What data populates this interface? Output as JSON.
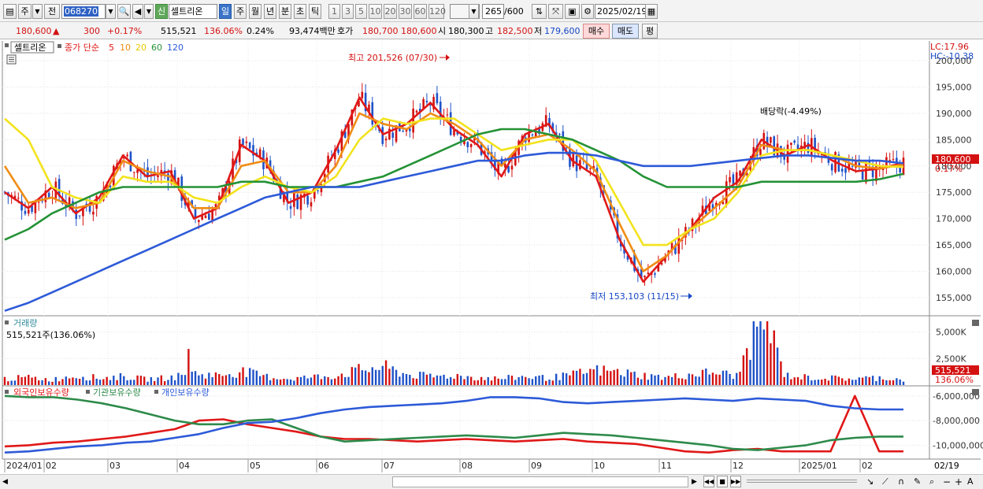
{
  "toolbar": {
    "market_type": "주",
    "prev_label": "전",
    "code": "068270",
    "credit_badge": "신",
    "stock_name": "셀트리온",
    "periods": [
      "일",
      "주",
      "월",
      "년",
      "분",
      "초",
      "틱"
    ],
    "active_period": "일",
    "intervals": [
      "1",
      "3",
      "5",
      "10",
      "20",
      "30",
      "60",
      "120"
    ],
    "count": "265",
    "count_total": "/600",
    "date": "2025/02/19"
  },
  "quote": {
    "price": "180,600",
    "change_symbol": "▲",
    "change": "300",
    "change_pct": "+0.17%",
    "volume": "515,521",
    "volume_ratio": "136.06%",
    "turnover": "0.24%",
    "amount": "93,474백만",
    "hoga_label": "호가",
    "bid1": "180,700",
    "bid2": "180,600",
    "open_label": "시",
    "open": "180,300",
    "high_label": "고",
    "high": "182,500",
    "low_label": "저",
    "low": "179,600",
    "buy_label": "매수",
    "sell_label": "매도",
    "eval_label": "평"
  },
  "price_panel": {
    "stock_label": "셀트리온",
    "ma_label": "종가 단순",
    "ma_periods": [
      "5",
      "10",
      "20",
      "60",
      "120"
    ],
    "max_annotation": "최고 201,526 (07/30)",
    "min_annotation": "최저 153,103 (11/15)",
    "dividend_annotation": "배당락(-4.49%)",
    "lc": "LC:17.96",
    "hc": "HC:-10.38",
    "current_price_tag": "180,600",
    "current_pct_tag": "0.17%",
    "y_ticks": [
      "200,000",
      "195,000",
      "190,000",
      "185,000",
      "180,000",
      "175,000",
      "170,000",
      "165,000",
      "160,000",
      "155,000"
    ]
  },
  "volume_panel": {
    "title": "거래량",
    "value": "515,521주(136.06%)",
    "y_ticks": [
      "5,000K",
      "2,500K"
    ],
    "current_tag": "515,521",
    "current_pct_tag": "136.06%"
  },
  "holding_panel": {
    "series_names": [
      "외국인보유수량",
      "기관보유수량",
      "개인보유수량"
    ],
    "y_ticks": [
      "-6,000,000",
      "-8,000,000",
      "-10,000,000"
    ]
  },
  "x_axis": {
    "labels": [
      "2024/01",
      "02",
      "03",
      "04",
      "05",
      "06",
      "07",
      "08",
      "09",
      "10",
      "11",
      "12",
      "2025/01",
      "02"
    ],
    "end_label": "02/19"
  },
  "colors": {
    "up": "#d41111",
    "down": "#1f52c8",
    "ma5": "#e01818",
    "ma10": "#f08c14",
    "ma20": "#f2e31c",
    "ma60": "#249236",
    "ma120": "#2d5ad8",
    "foreign": "#e01818",
    "institution": "#2d8a4a",
    "individual": "#2d5ad8"
  },
  "chart_data": [
    {
      "type": "candlestick",
      "title": "셀트리온",
      "x_range": [
        "2024/01",
        "2025/02/19"
      ],
      "ylim": [
        152000,
        201500
      ],
      "series": [
        {
          "name": "5",
          "values": [
            175000,
            172000,
            176000,
            171000,
            174000,
            182000,
            178000,
            179000,
            170000,
            172000,
            184000,
            181000,
            173000,
            175000,
            183000,
            193000,
            186000,
            188000,
            192000,
            187000,
            184000,
            178000,
            186000,
            188000,
            181000,
            178000,
            166000,
            158000,
            163000,
            168000,
            174000,
            177000,
            185000,
            182000,
            184000,
            181000,
            179000,
            179500,
            180600
          ]
        },
        {
          "name": "10",
          "values": [
            180000,
            173000,
            174000,
            172000,
            173000,
            181000,
            179000,
            178000,
            172000,
            172000,
            180000,
            181000,
            175000,
            175000,
            180000,
            190000,
            188000,
            187000,
            190000,
            188000,
            185000,
            180000,
            185000,
            186000,
            183000,
            179000,
            169000,
            160000,
            163000,
            168000,
            172000,
            176000,
            184000,
            183000,
            183000,
            182000,
            180000,
            179500,
            180300
          ]
        },
        {
          "name": "20",
          "values": [
            189000,
            185000,
            176000,
            174000,
            173000,
            178000,
            177000,
            177000,
            174000,
            173000,
            176000,
            178000,
            176000,
            175000,
            178000,
            185000,
            189000,
            188000,
            189000,
            189000,
            186000,
            183000,
            184000,
            185000,
            185000,
            181000,
            173000,
            165000,
            165000,
            168000,
            170000,
            175000,
            182000,
            183000,
            183000,
            182000,
            181000,
            180000,
            179800
          ]
        },
        {
          "name": "60",
          "values": [
            166000,
            168000,
            171000,
            173000,
            175000,
            176000,
            176000,
            176000,
            176000,
            176000,
            177000,
            177000,
            176000,
            176000,
            176000,
            177000,
            178000,
            180000,
            182000,
            184000,
            186000,
            187000,
            187000,
            186000,
            185000,
            183000,
            181000,
            178000,
            176000,
            176000,
            176000,
            176000,
            177000,
            177000,
            177000,
            177000,
            177000,
            177500,
            178500
          ]
        },
        {
          "name": "120",
          "values": [
            152500,
            154000,
            156000,
            158000,
            160000,
            162000,
            164000,
            166000,
            168000,
            170000,
            172000,
            174000,
            175000,
            176000,
            176000,
            176000,
            177000,
            178000,
            179000,
            180000,
            181000,
            181000,
            182000,
            182500,
            182500,
            182000,
            181000,
            180000,
            180000,
            180000,
            180500,
            181000,
            181500,
            182000,
            182000,
            181500,
            181000,
            181000,
            180500
          ]
        }
      ]
    },
    {
      "type": "bar",
      "title": "거래량",
      "ylim": [
        0,
        6000000
      ],
      "values": [
        600,
        700,
        500,
        900,
        650,
        800,
        550,
        700,
        1100,
        900,
        1300,
        800,
        600,
        750,
        900,
        1400,
        1700,
        1000,
        800,
        900,
        700,
        600,
        800,
        650,
        950,
        1400,
        1200,
        900,
        700,
        1000,
        1200,
        850,
        7200,
        900,
        700,
        650,
        600,
        700,
        515
      ]
    },
    {
      "type": "line",
      "ylim": [
        -11000000,
        -5500000
      ],
      "series": [
        {
          "name": "외국인보유수량",
          "values": [
            -10100000,
            -10000000,
            -9800000,
            -9700000,
            -9500000,
            -9300000,
            -9000000,
            -8700000,
            -8000000,
            -7900000,
            -8300000,
            -8600000,
            -8900000,
            -9300000,
            -9500000,
            -9500000,
            -9600000,
            -9700000,
            -9600000,
            -9500000,
            -9600000,
            -9700000,
            -9600000,
            -9500000,
            -9700000,
            -9800000,
            -9900000,
            -10200000,
            -10500000,
            -10600000,
            -10400000,
            -10300000,
            -10500000,
            -10500000,
            -10500000,
            -6000000,
            -10500000,
            -10500000
          ]
        },
        {
          "name": "기관보유수량",
          "values": [
            -6000000,
            -6100000,
            -6100000,
            -6300000,
            -6600000,
            -7000000,
            -7500000,
            -8000000,
            -8300000,
            -8300000,
            -8000000,
            -7900000,
            -8600000,
            -9300000,
            -9700000,
            -9600000,
            -9500000,
            -9400000,
            -9300000,
            -9200000,
            -9300000,
            -9400000,
            -9200000,
            -9000000,
            -9100000,
            -9200000,
            -9400000,
            -9600000,
            -9800000,
            -10000000,
            -10300000,
            -10400000,
            -10200000,
            -10000000,
            -9600000,
            -9400000,
            -9300000,
            -9300000
          ]
        },
        {
          "name": "개인보유수량",
          "values": [
            -10600000,
            -10500000,
            -10300000,
            -10100000,
            -10000000,
            -9800000,
            -9700000,
            -9400000,
            -9100000,
            -8600000,
            -8200000,
            -8100000,
            -7800000,
            -7400000,
            -7100000,
            -6900000,
            -6800000,
            -6700000,
            -6600000,
            -6400000,
            -6100000,
            -6100000,
            -6200000,
            -6500000,
            -6600000,
            -6500000,
            -6400000,
            -6300000,
            -6200000,
            -6300000,
            -6400000,
            -6200000,
            -6300000,
            -6400000,
            -6800000,
            -7000000,
            -7100000,
            -7100000
          ]
        }
      ]
    }
  ]
}
